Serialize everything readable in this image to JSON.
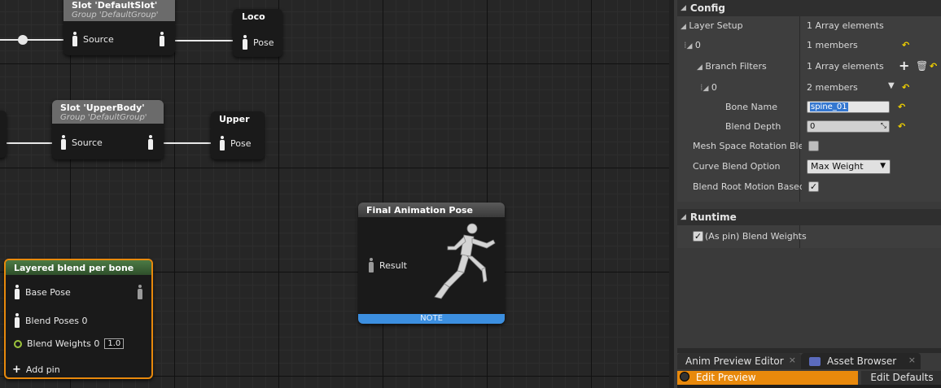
{
  "graph": {
    "slot_default": {
      "title": "Slot 'DefaultSlot'",
      "group": "Group 'DefaultGroup'",
      "pin": "Source"
    },
    "loco": {
      "title": "Loco",
      "pin": "Pose"
    },
    "slot_upper": {
      "title": "Slot 'UpperBody'",
      "group": "Group 'DefaultGroup'",
      "pin": "Source"
    },
    "upper": {
      "title": "Upper",
      "pin": "Pose"
    },
    "final_pose": {
      "title": "Final Animation Pose",
      "pin": "Result",
      "note": "NOTE"
    },
    "layered_blend": {
      "title": "Layered blend per bone",
      "base_pose": "Base Pose",
      "blend_poses": "Blend Poses 0",
      "blend_weights": "Blend Weights 0",
      "blend_weights_value": "1.0",
      "add_pin": "Add pin"
    }
  },
  "details": {
    "config": {
      "title": "Config",
      "layer_setup": {
        "label": "Layer Setup",
        "value": "1 Array elements"
      },
      "element_0": {
        "label": "0",
        "value": "1 members"
      },
      "branch_filters": {
        "label": "Branch Filters",
        "value": "1 Array elements"
      },
      "filter_0": {
        "label": "0",
        "value": "2 members"
      },
      "bone_name": {
        "label": "Bone Name",
        "value": "spine_01"
      },
      "blend_depth": {
        "label": "Blend Depth",
        "value": "0"
      },
      "mesh_space": {
        "label": "Mesh Space Rotation Blend"
      },
      "curve_blend": {
        "label": "Curve Blend Option",
        "value": "Max Weight"
      },
      "root_motion": {
        "label": "Blend Root Motion Based on Root Bone"
      }
    },
    "runtime": {
      "title": "Runtime",
      "as_pin_label": "(As pin) Blend Weights"
    }
  },
  "tabs": {
    "anim_preview": "Anim Preview Editor",
    "asset_browser": "Asset Browser"
  },
  "bottom_bar": {
    "edit_preview": "Edit Preview",
    "edit_defaults": "Edit Defaults"
  },
  "colors": {
    "accent_orange": "#e8890c",
    "note_blue": "#3c8fe0",
    "reset_yellow": "#f0d000"
  }
}
